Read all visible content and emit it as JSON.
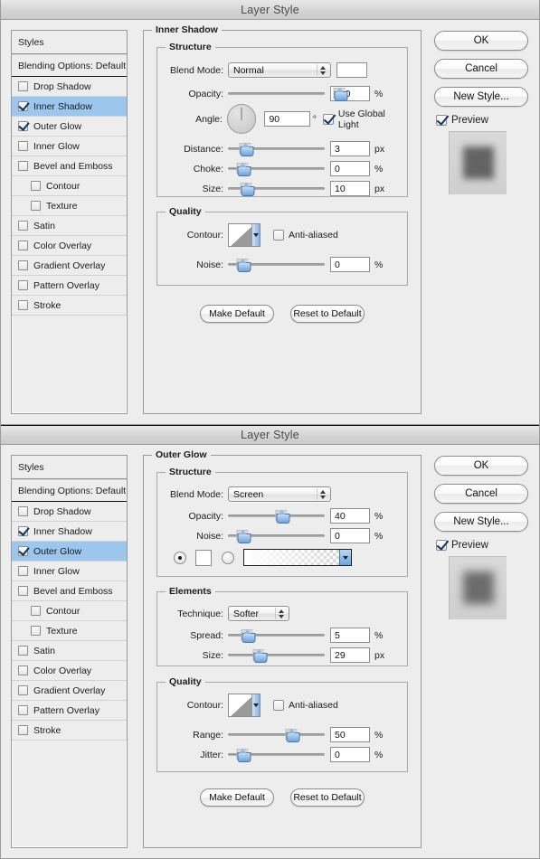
{
  "window1": {
    "title": "Layer Style",
    "styles_header": "Styles",
    "blending_options": "Blending Options: Default",
    "effects": [
      {
        "label": "Drop Shadow",
        "checked": false,
        "selected": false,
        "indent": false
      },
      {
        "label": "Inner Shadow",
        "checked": true,
        "selected": true,
        "indent": false
      },
      {
        "label": "Outer Glow",
        "checked": true,
        "selected": false,
        "indent": false
      },
      {
        "label": "Inner Glow",
        "checked": false,
        "selected": false,
        "indent": false
      },
      {
        "label": "Bevel and Emboss",
        "checked": false,
        "selected": false,
        "indent": false
      },
      {
        "label": "Contour",
        "checked": false,
        "selected": false,
        "indent": true
      },
      {
        "label": "Texture",
        "checked": false,
        "selected": false,
        "indent": true
      },
      {
        "label": "Satin",
        "checked": false,
        "selected": false,
        "indent": false
      },
      {
        "label": "Color Overlay",
        "checked": false,
        "selected": false,
        "indent": false
      },
      {
        "label": "Gradient Overlay",
        "checked": false,
        "selected": false,
        "indent": false
      },
      {
        "label": "Pattern Overlay",
        "checked": false,
        "selected": false,
        "indent": false
      },
      {
        "label": "Stroke",
        "checked": false,
        "selected": false,
        "indent": false
      }
    ],
    "panel_title": "Inner Shadow",
    "structure": {
      "legend": "Structure",
      "blend_mode_label": "Blend Mode:",
      "blend_mode_value": "Normal",
      "opacity_label": "Opacity:",
      "opacity_value": "100",
      "opacity_unit": "%",
      "opacity_pct": 100,
      "angle_label": "Angle:",
      "angle_value": "90",
      "angle_unit": "°",
      "use_global_light": "Use Global Light",
      "use_global_light_checked": true,
      "distance_label": "Distance:",
      "distance_value": "3",
      "distance_unit": "px",
      "distance_pct": 3,
      "choke_label": "Choke:",
      "choke_value": "0",
      "choke_unit": "%",
      "choke_pct": 0,
      "size_label": "Size:",
      "size_value": "10",
      "size_unit": "px",
      "size_pct": 4
    },
    "quality": {
      "legend": "Quality",
      "contour_label": "Contour:",
      "anti_aliased": "Anti-aliased",
      "anti_aliased_checked": false,
      "noise_label": "Noise:",
      "noise_value": "0",
      "noise_unit": "%",
      "noise_pct": 0
    },
    "make_default": "Make Default",
    "reset_to_default": "Reset to Default",
    "buttons": {
      "ok": "OK",
      "cancel": "Cancel",
      "new_style": "New Style...",
      "preview": "Preview",
      "preview_checked": true
    }
  },
  "window2": {
    "title": "Layer Style",
    "styles_header": "Styles",
    "blending_options": "Blending Options: Default",
    "effects": [
      {
        "label": "Drop Shadow",
        "checked": false,
        "selected": false,
        "indent": false
      },
      {
        "label": "Inner Shadow",
        "checked": true,
        "selected": false,
        "indent": false
      },
      {
        "label": "Outer Glow",
        "checked": true,
        "selected": true,
        "indent": false
      },
      {
        "label": "Inner Glow",
        "checked": false,
        "selected": false,
        "indent": false
      },
      {
        "label": "Bevel and Emboss",
        "checked": false,
        "selected": false,
        "indent": false
      },
      {
        "label": "Contour",
        "checked": false,
        "selected": false,
        "indent": true
      },
      {
        "label": "Texture",
        "checked": false,
        "selected": false,
        "indent": true
      },
      {
        "label": "Satin",
        "checked": false,
        "selected": false,
        "indent": false
      },
      {
        "label": "Color Overlay",
        "checked": false,
        "selected": false,
        "indent": false
      },
      {
        "label": "Gradient Overlay",
        "checked": false,
        "selected": false,
        "indent": false
      },
      {
        "label": "Pattern Overlay",
        "checked": false,
        "selected": false,
        "indent": false
      },
      {
        "label": "Stroke",
        "checked": false,
        "selected": false,
        "indent": false
      }
    ],
    "panel_title": "Outer Glow",
    "structure": {
      "legend": "Structure",
      "blend_mode_label": "Blend Mode:",
      "blend_mode_value": "Screen",
      "opacity_label": "Opacity:",
      "opacity_value": "40",
      "opacity_unit": "%",
      "opacity_pct": 40,
      "noise_label": "Noise:",
      "noise_value": "0",
      "noise_unit": "%",
      "noise_pct": 0,
      "fill_type_color_selected": true,
      "fill_type_gradient_selected": false,
      "color_swatch": "#ffffff",
      "gradient": "white-to-transparent"
    },
    "elements": {
      "legend": "Elements",
      "technique_label": "Technique:",
      "technique_value": "Softer",
      "spread_label": "Spread:",
      "spread_value": "5",
      "spread_unit": "%",
      "spread_pct": 5,
      "size_label": "Size:",
      "size_value": "29",
      "size_unit": "px",
      "size_pct": 17
    },
    "quality": {
      "legend": "Quality",
      "contour_label": "Contour:",
      "anti_aliased": "Anti-aliased",
      "anti_aliased_checked": false,
      "range_label": "Range:",
      "range_value": "50",
      "range_unit": "%",
      "range_pct": 50,
      "jitter_label": "Jitter:",
      "jitter_value": "0",
      "jitter_unit": "%",
      "jitter_pct": 0
    },
    "make_default": "Make Default",
    "reset_to_default": "Reset to Default",
    "buttons": {
      "ok": "OK",
      "cancel": "Cancel",
      "new_style": "New Style...",
      "preview": "Preview",
      "preview_checked": true
    }
  },
  "colors": {
    "selection_blue": "#9cc6ee",
    "window_bg": "#ededed",
    "titlebar": "#d4d4d4",
    "slider_thumb": "#6ba4dd"
  }
}
